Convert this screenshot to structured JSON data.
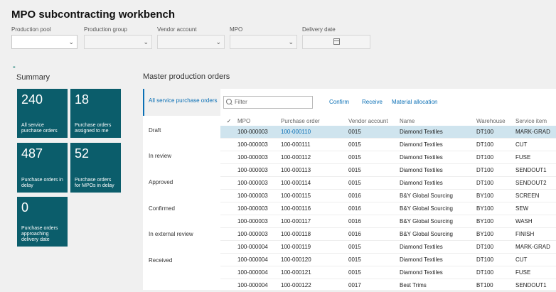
{
  "page": {
    "title": "MPO subcontracting workbench"
  },
  "filters": [
    {
      "label": "Production pool",
      "type": "select"
    },
    {
      "label": "Production group",
      "type": "select"
    },
    {
      "label": "Vendor account",
      "type": "select"
    },
    {
      "label": "MPO",
      "type": "select"
    },
    {
      "label": "Delivery date",
      "type": "date"
    }
  ],
  "summary": {
    "heading": "Summary",
    "tiles": [
      {
        "value": "240",
        "label": "All service purchase orders"
      },
      {
        "value": "18",
        "label": "Purchase orders assigned to me"
      },
      {
        "value": "487",
        "label": "Purchase orders in delay"
      },
      {
        "value": "52",
        "label": "Purchase orders for MPOs in delay"
      },
      {
        "value": "0",
        "label": "Purchase orders approaching delivery date"
      }
    ]
  },
  "mpo": {
    "heading": "Master production orders",
    "nav": [
      "All service purchase orders",
      "Draft",
      "In review",
      "Approved",
      "Confirmed",
      "In external review",
      "Received"
    ],
    "filter_placeholder": "Filter",
    "actions": [
      "Confirm",
      "Receive",
      "Material allocation"
    ],
    "columns": [
      "MPO",
      "Purchase order",
      "Vendor account",
      "Name",
      "Warehouse",
      "Service item"
    ],
    "rows": [
      [
        "100-000003",
        "100-000110",
        "0015",
        "Diamond Textiles",
        "DT100",
        "MARK-GRAD"
      ],
      [
        "100-000003",
        "100-000111",
        "0015",
        "Diamond Textiles",
        "DT100",
        "CUT"
      ],
      [
        "100-000003",
        "100-000112",
        "0015",
        "Diamond Textiles",
        "DT100",
        "FUSE"
      ],
      [
        "100-000003",
        "100-000113",
        "0015",
        "Diamond Textiles",
        "DT100",
        "SENDOUT1"
      ],
      [
        "100-000003",
        "100-000114",
        "0015",
        "Diamond Textiles",
        "DT100",
        "SENDOUT2"
      ],
      [
        "100-000003",
        "100-000115",
        "0016",
        "B&Y Global Sourcing",
        "BY100",
        "SCREEN"
      ],
      [
        "100-000003",
        "100-000116",
        "0016",
        "B&Y Global Sourcing",
        "BY100",
        "SEW"
      ],
      [
        "100-000003",
        "100-000117",
        "0016",
        "B&Y Global Sourcing",
        "BY100",
        "WASH"
      ],
      [
        "100-000003",
        "100-000118",
        "0016",
        "B&Y Global Sourcing",
        "BY100",
        "FINISH"
      ],
      [
        "100-000004",
        "100-000119",
        "0015",
        "Diamond Textiles",
        "DT100",
        "MARK-GRAD"
      ],
      [
        "100-000004",
        "100-000120",
        "0015",
        "Diamond Textiles",
        "DT100",
        "CUT"
      ],
      [
        "100-000004",
        "100-000121",
        "0015",
        "Diamond Textiles",
        "DT100",
        "FUSE"
      ],
      [
        "100-000004",
        "100-000122",
        "0017",
        "Best Trims",
        "BT100",
        "SENDOUT1"
      ]
    ],
    "selected_row": 0
  }
}
